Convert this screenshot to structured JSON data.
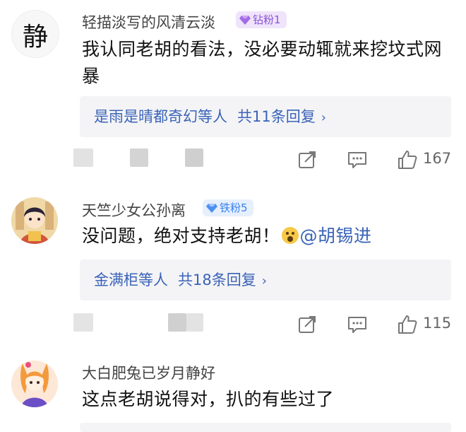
{
  "comments": [
    {
      "avatar_text": "静",
      "username": "轻描淡写的风清云淡",
      "badge": "钻粉1",
      "badge_color": "#8b52d6",
      "text": "我认同老胡的看法，没必要动辄就来挖坟式网暴",
      "replies_names": "是雨是晴都奇幻等人",
      "replies_count": "共11条回复",
      "likes": "167"
    },
    {
      "username": "天竺少女公孙离",
      "badge": "铁粉5",
      "badge_color": "#3b82f0",
      "text": "没问题，绝对支持老胡！",
      "mention": "@胡锡进",
      "replies_names": "金满柜等人",
      "replies_count": "共18条回复",
      "likes": "115"
    },
    {
      "username": "大白肥兔已岁月静好",
      "text": "这点老胡说得对，扒的有些过了"
    }
  ],
  "icons": {
    "chevron": "chevron-right-icon",
    "share": "share-icon",
    "comment": "comment-icon",
    "like": "like-icon"
  }
}
